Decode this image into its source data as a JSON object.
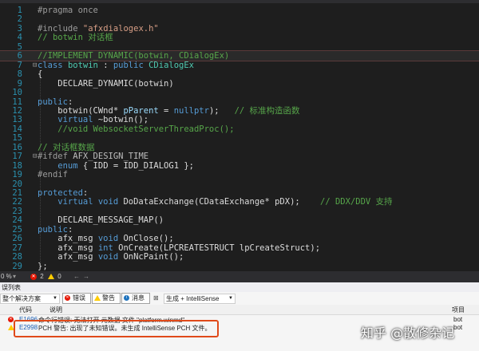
{
  "editor": {
    "lines": [
      {
        "n": "1",
        "fold": "",
        "tokens": [
          {
            "t": "#pragma once",
            "c": "#9b9b9b"
          }
        ]
      },
      {
        "n": "2",
        "fold": "",
        "tokens": []
      },
      {
        "n": "3",
        "fold": "",
        "tokens": [
          {
            "t": "#include ",
            "c": "#9b9b9b"
          },
          {
            "t": "\"afxdialogex.h\"",
            "c": "#d69d85"
          }
        ]
      },
      {
        "n": "4",
        "fold": "",
        "tokens": [
          {
            "t": "// botwin 对话框",
            "c": "#57a64a"
          }
        ]
      },
      {
        "n": "5",
        "fold": "",
        "tokens": []
      },
      {
        "n": "6",
        "fold": "",
        "hl": true,
        "tokens": [
          {
            "t": "//IMPLEMENT_DYNAMIC(botwin, CDialogEx)",
            "c": "#57a64a"
          }
        ]
      },
      {
        "n": "7",
        "fold": "⊟",
        "tokens": [
          {
            "t": "class ",
            "c": "#569cd6"
          },
          {
            "t": "botwin",
            "c": "#4ec9b0"
          },
          {
            "t": " : ",
            "c": "#dcdcdc"
          },
          {
            "t": "public ",
            "c": "#569cd6"
          },
          {
            "t": "CDialogEx",
            "c": "#4ec9b0"
          }
        ]
      },
      {
        "n": "8",
        "fold": "",
        "tokens": [
          {
            "t": "{",
            "c": "#dcdcdc"
          }
        ]
      },
      {
        "n": "9",
        "fold": "",
        "tokens": [
          {
            "t": "    DECLARE_DYNAMIC(botwin)",
            "c": "#dcdcdc"
          }
        ]
      },
      {
        "n": "10",
        "fold": "",
        "tokens": []
      },
      {
        "n": "11",
        "fold": "",
        "tokens": [
          {
            "t": "public",
            "c": "#569cd6"
          },
          {
            "t": ":",
            "c": "#dcdcdc"
          }
        ]
      },
      {
        "n": "12",
        "fold": "",
        "tokens": [
          {
            "t": "    botwin(CWnd* ",
            "c": "#dcdcdc"
          },
          {
            "t": "pParent",
            "c": "#9cdcfe"
          },
          {
            "t": " = ",
            "c": "#dcdcdc"
          },
          {
            "t": "nullptr",
            "c": "#569cd6"
          },
          {
            "t": ");   ",
            "c": "#dcdcdc"
          },
          {
            "t": "// 标准构造函数",
            "c": "#57a64a"
          }
        ]
      },
      {
        "n": "13",
        "fold": "",
        "tokens": [
          {
            "t": "    virtual ",
            "c": "#569cd6"
          },
          {
            "t": "~botwin();",
            "c": "#dcdcdc"
          }
        ]
      },
      {
        "n": "14",
        "fold": "",
        "tokens": [
          {
            "t": "    //void WebsocketServerThreadProc();",
            "c": "#57a64a"
          }
        ]
      },
      {
        "n": "15",
        "fold": "",
        "tokens": []
      },
      {
        "n": "16",
        "fold": "",
        "tokens": [
          {
            "t": "// 对话框数据",
            "c": "#57a64a"
          }
        ]
      },
      {
        "n": "17",
        "fold": "⊟",
        "tokens": [
          {
            "t": "#ifdef ",
            "c": "#9b9b9b"
          },
          {
            "t": "AFX_DESIGN_TIME",
            "c": "#bdbdbd"
          }
        ]
      },
      {
        "n": "18",
        "fold": "",
        "tokens": [
          {
            "t": "    enum ",
            "c": "#569cd6"
          },
          {
            "t": "{ IDD = IDD_DIALOG1 };",
            "c": "#dcdcdc"
          }
        ]
      },
      {
        "n": "19",
        "fold": "",
        "tokens": [
          {
            "t": "#endif",
            "c": "#9b9b9b"
          }
        ]
      },
      {
        "n": "20",
        "fold": "",
        "tokens": []
      },
      {
        "n": "21",
        "fold": "",
        "tokens": [
          {
            "t": "protected",
            "c": "#569cd6"
          },
          {
            "t": ":",
            "c": "#dcdcdc"
          }
        ]
      },
      {
        "n": "22",
        "fold": "",
        "tokens": [
          {
            "t": "    virtual ",
            "c": "#569cd6"
          },
          {
            "t": "void ",
            "c": "#569cd6"
          },
          {
            "t": "DoDataExchange(CDataExchange* pDX);    ",
            "c": "#dcdcdc"
          },
          {
            "t": "// DDX/DDV 支持",
            "c": "#57a64a"
          }
        ]
      },
      {
        "n": "23",
        "fold": "",
        "tokens": []
      },
      {
        "n": "24",
        "fold": "",
        "tokens": [
          {
            "t": "    DECLARE_MESSAGE_MAP()",
            "c": "#dcdcdc"
          }
        ]
      },
      {
        "n": "25",
        "fold": "",
        "tokens": [
          {
            "t": "public",
            "c": "#569cd6"
          },
          {
            "t": ":",
            "c": "#dcdcdc"
          }
        ]
      },
      {
        "n": "26",
        "fold": "",
        "tokens": [
          {
            "t": "    afx_msg ",
            "c": "#dcdcdc"
          },
          {
            "t": "void ",
            "c": "#569cd6"
          },
          {
            "t": "OnClose();",
            "c": "#dcdcdc"
          }
        ]
      },
      {
        "n": "27",
        "fold": "",
        "tokens": [
          {
            "t": "    afx_msg ",
            "c": "#dcdcdc"
          },
          {
            "t": "int ",
            "c": "#569cd6"
          },
          {
            "t": "OnCreate(LPCREATESTRUCT lpCreateStruct);",
            "c": "#dcdcdc"
          }
        ]
      },
      {
        "n": "28",
        "fold": "",
        "tokens": [
          {
            "t": "    afx_msg ",
            "c": "#dcdcdc"
          },
          {
            "t": "void ",
            "c": "#569cd6"
          },
          {
            "t": "OnNcPaint();",
            "c": "#dcdcdc"
          }
        ]
      },
      {
        "n": "29",
        "fold": "",
        "tokens": [
          {
            "t": "};",
            "c": "#dcdcdc"
          }
        ]
      }
    ]
  },
  "status": {
    "zoom": "0 %",
    "errors": "2",
    "warnings": "0"
  },
  "error_list": {
    "title": "误列表",
    "scope": "整个解决方案",
    "errors_btn": "错误 2",
    "warnings_btn": "警告 0",
    "messages_btn": "消息 0",
    "build_filter": "生成 + IntelliSense",
    "col_code": "代码",
    "col_desc": "说明",
    "col_project": "项目",
    "rows": [
      {
        "code": "E1696",
        "desc": "命令行错误: 无法打开 元数据 文件 \"platform.winmd\"",
        "project": "bot"
      },
      {
        "code": "E2998",
        "desc": "PCH 警告: 出现了未知错误。未生成 IntelliSense PCH 文件。",
        "project": "bot"
      }
    ]
  },
  "watermark": "知乎 @散修杂记",
  "colors": {
    "error": "#e51400",
    "warning": "#ffcc00",
    "highlight_box": "#e04a1a"
  }
}
